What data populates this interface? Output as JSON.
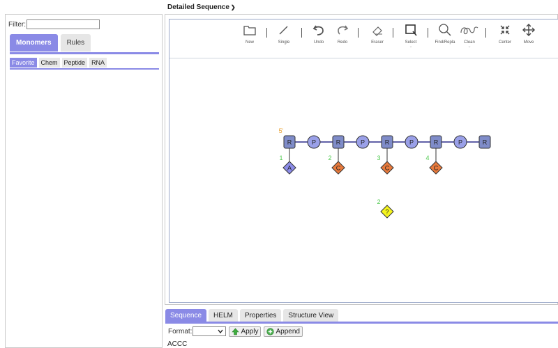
{
  "left_panel": {
    "filter_label": "Filter:",
    "filter_value": "",
    "tabs": [
      "Monomers",
      "Rules"
    ],
    "sub_tabs": [
      "Favorite",
      "Chem",
      "Peptide",
      "RNA"
    ]
  },
  "header": {
    "title": "Detailed Sequence",
    "chevron": "chevron-down-icon"
  },
  "toolbar": {
    "tools": [
      {
        "label": "New",
        "icon": "folder-icon"
      },
      {
        "label": "Single",
        "icon": "single-bond-icon"
      },
      {
        "label": "Undo",
        "icon": "undo-icon"
      },
      {
        "label": "Redo",
        "icon": "redo-icon"
      },
      {
        "label": "Eraser",
        "icon": "eraser-icon"
      },
      {
        "label": "Select",
        "icon": "select-icon"
      },
      {
        "label": "Find/Repla",
        "icon": "magnifier-icon"
      },
      {
        "label": "Clean",
        "icon": "clean-icon"
      },
      {
        "label": "Center",
        "icon": "center-icon"
      },
      {
        "label": "Move",
        "icon": "move-icon"
      }
    ]
  },
  "molecule": {
    "end_label": "5'",
    "backbone": [
      "R",
      "P",
      "R",
      "P",
      "R",
      "P",
      "R",
      "P",
      "R"
    ],
    "bases": [
      {
        "number": "1",
        "label": "A",
        "color": "#8c8ce8"
      },
      {
        "number": "2",
        "label": "C",
        "color": "#e87a3c"
      },
      {
        "number": "3",
        "label": "C",
        "color": "#e87a3c"
      },
      {
        "number": "4",
        "label": "C",
        "color": "#e87a3c"
      }
    ],
    "free_monomer": {
      "number": "2",
      "label": "?",
      "color": "#f5f51e"
    },
    "colors": {
      "sugar_fill": "#7f8cc9",
      "phosphate_fill": "#9aa0e8",
      "bond": "#2b2b8a",
      "number": "#4ec94e",
      "end_label": "#e8a030"
    }
  },
  "bottom_panel": {
    "tabs": [
      "Sequence",
      "HELM",
      "Properties",
      "Structure View"
    ],
    "format_label": "Format:",
    "format_value": "",
    "apply_label": "Apply",
    "append_label": "Append",
    "sequence": "ACCC"
  }
}
